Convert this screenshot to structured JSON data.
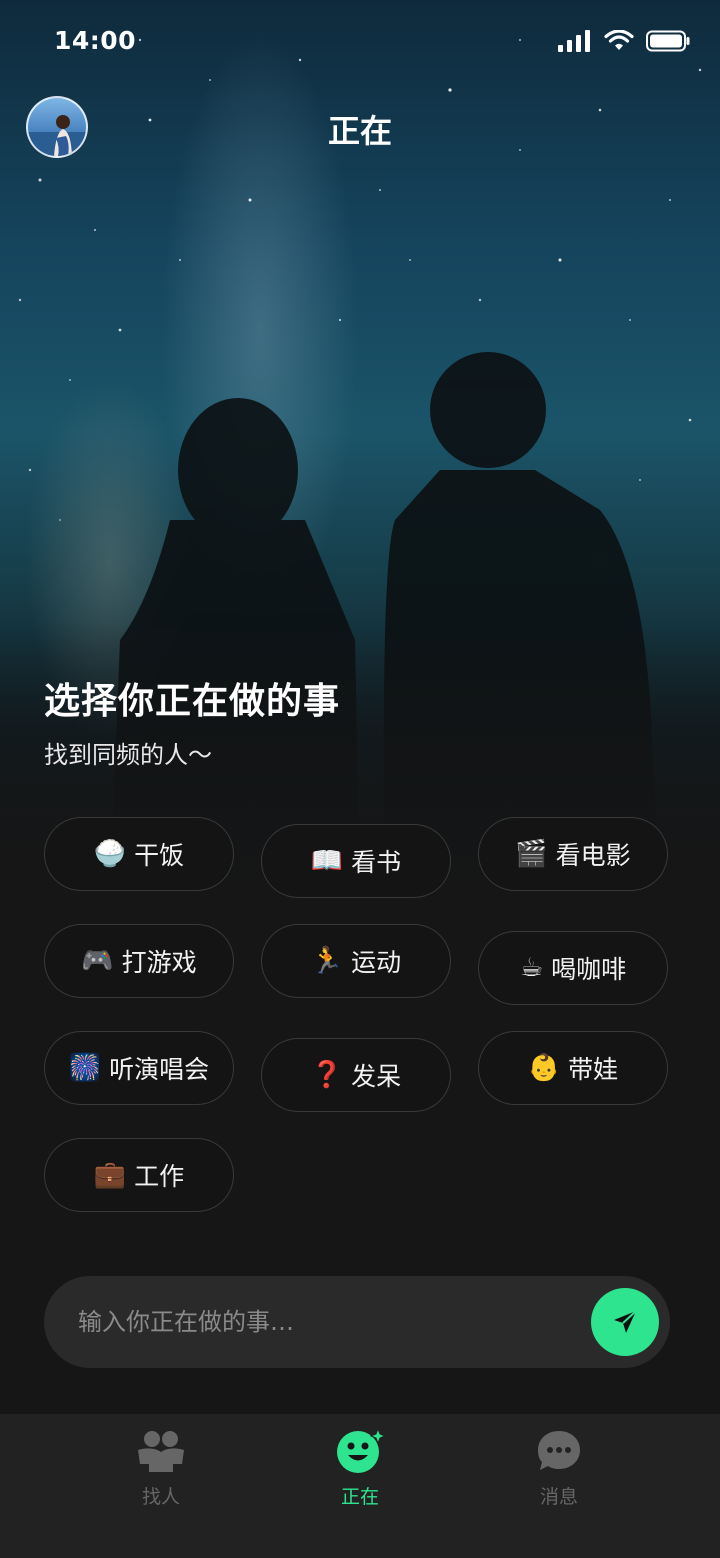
{
  "status_bar": {
    "time": "14:00"
  },
  "header": {
    "title": "正在"
  },
  "hero": {
    "headline": "选择你正在做的事",
    "subline": "找到同频的人～"
  },
  "activities": [
    {
      "emoji": "🍚",
      "label": "干饭"
    },
    {
      "emoji": "📖",
      "label": "看书"
    },
    {
      "emoji": "🎬",
      "label": "看电影"
    },
    {
      "emoji": "🎮",
      "label": "打游戏"
    },
    {
      "emoji": "🏃",
      "label": "运动"
    },
    {
      "emoji": "☕",
      "label": "喝咖啡"
    },
    {
      "emoji": "🎆",
      "label": "听演唱会"
    },
    {
      "emoji": "❓",
      "label": "发呆"
    },
    {
      "emoji": "👶",
      "label": "带娃"
    },
    {
      "emoji": "💼",
      "label": "工作"
    }
  ],
  "input": {
    "placeholder": "输入你正在做的事…"
  },
  "tabbar": {
    "tabs": [
      {
        "label": "找人",
        "icon": "people-icon"
      },
      {
        "label": "正在",
        "icon": "smiley-icon",
        "active": true
      },
      {
        "label": "消息",
        "icon": "chat-icon"
      }
    ]
  },
  "colors": {
    "accent": "#2ee48e",
    "background": "#161616",
    "tabbar": "#222222",
    "inactive": "#666666"
  }
}
